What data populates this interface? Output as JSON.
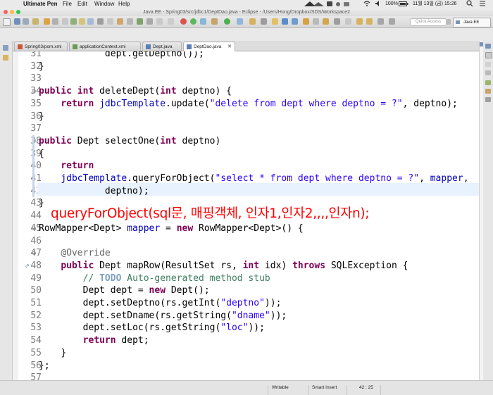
{
  "menubar": {
    "apple_glyph": "",
    "app_name": "Ultimate Pen",
    "items": [
      "File",
      "Edit",
      "Window",
      "Help"
    ],
    "battery": "100%",
    "datetime": "11월 13일 (금) 15:26"
  },
  "window": {
    "title": "Java EE - Spring03/src/jdbc1/DeptDao.java - Eclipse - /Users/Hong/Dropbox/SDS/Workspace2"
  },
  "toolbar": {
    "quick_access_placeholder": "Quick Access",
    "perspective_label": "Java EE"
  },
  "tabs": [
    {
      "label": "Spring03/pom.xml",
      "icon": "maven-pom-icon"
    },
    {
      "label": "applicationContext.xml",
      "icon": "xml-file-icon"
    },
    {
      "label": "Dept.java",
      "icon": "java-file-icon"
    },
    {
      "label": "DeptDao.java",
      "icon": "java-file-icon",
      "active": true,
      "close": "✕"
    }
  ],
  "editor": {
    "line_numbers": [
      "31",
      "32",
      "33",
      "34",
      "35",
      "36",
      "37",
      "38",
      "39",
      "40",
      "41",
      "42",
      "43",
      "44",
      "45",
      "46",
      "47",
      "48",
      "49",
      "50",
      "51",
      "52",
      "53",
      "54",
      "55",
      "56",
      "57"
    ],
    "annotation_overlay": "queryForObject(sql문, 매핑객체, 인자1,인자2,,,,인자n);"
  },
  "statusbar": {
    "writable": "Writable",
    "insert_mode": "Smart Insert",
    "cursor_position": "42 : 25"
  },
  "colors": {
    "keyword": "#7f0055",
    "string": "#2a00ff",
    "field": "#0000c0",
    "comment": "#3f7f5f",
    "current_line": "#e8f1fe",
    "annotation": "#ff0000"
  }
}
